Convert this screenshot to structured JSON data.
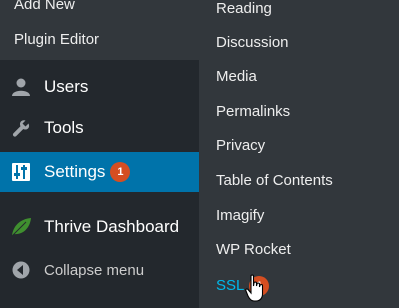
{
  "sidebar": {
    "submenu_items": [
      {
        "label": "Add New"
      },
      {
        "label": "Plugin Editor"
      }
    ],
    "menu_items": [
      {
        "label": "Users",
        "icon": "users-icon"
      },
      {
        "label": "Tools",
        "icon": "wrench-icon"
      },
      {
        "label": "Settings",
        "icon": "settings-sliders-icon",
        "badge": "1",
        "active": true
      },
      {
        "label": "Thrive Dashboard",
        "icon": "leaf-icon"
      },
      {
        "label": "Collapse menu",
        "icon": "collapse-arrow-icon"
      }
    ]
  },
  "flyout": {
    "items": [
      {
        "label": "Reading"
      },
      {
        "label": "Discussion"
      },
      {
        "label": "Media"
      },
      {
        "label": "Permalinks"
      },
      {
        "label": "Privacy"
      },
      {
        "label": "Table of Contents"
      },
      {
        "label": "Imagify"
      },
      {
        "label": "WP Rocket"
      },
      {
        "label": "SSL",
        "badge": "1",
        "current": true
      }
    ]
  },
  "colors": {
    "sidebar_bg": "#23282d",
    "submenu_bg": "#32373c",
    "active_bg": "#0073aa",
    "badge_bg": "#d54e21",
    "current_link": "#00b9eb"
  }
}
